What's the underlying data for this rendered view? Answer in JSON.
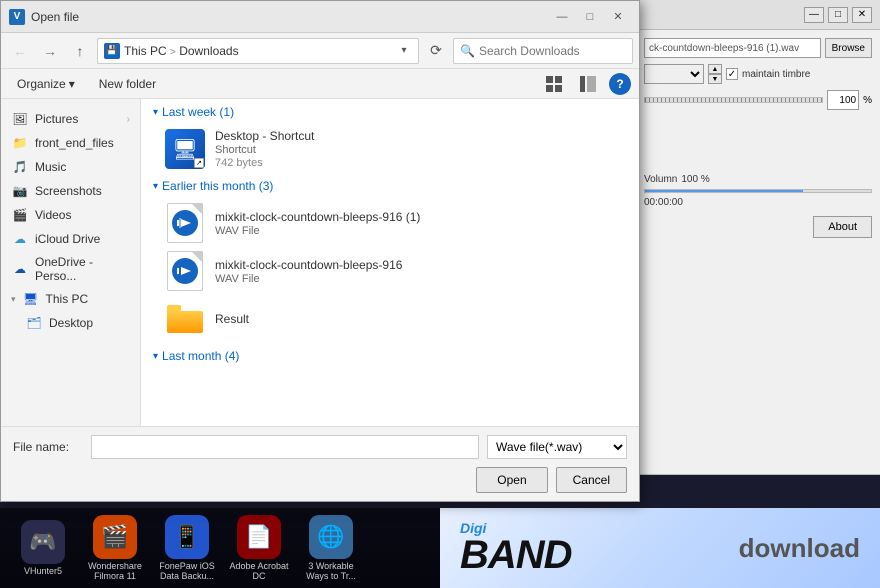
{
  "dialog": {
    "title": "Open file",
    "title_icon": "V",
    "nav": {
      "back_label": "←",
      "forward_label": "→",
      "up_label": "↑",
      "this_pc": "This PC",
      "separator": ">",
      "downloads": "Downloads",
      "dropdown_label": "▾",
      "refresh_label": "⟳",
      "search_placeholder": "Search Downloads"
    },
    "toolbar": {
      "organize_label": "Organize",
      "organize_arrow": "▾",
      "new_folder_label": "New folder",
      "view_label": "⊞",
      "help_label": "?"
    },
    "sidebar": {
      "items": [
        {
          "name": "Pictures",
          "icon": "🖼",
          "expanded": false
        },
        {
          "name": "front_end_files",
          "icon": "📁",
          "expanded": false
        },
        {
          "name": "Music",
          "icon": "🎵",
          "expanded": false
        },
        {
          "name": "Screenshots",
          "icon": "📷",
          "expanded": false
        },
        {
          "name": "Videos",
          "icon": "🎬",
          "expanded": false
        },
        {
          "name": "iCloud Drive",
          "icon": "☁",
          "expanded": false
        },
        {
          "name": "OneDrive - Perso...",
          "icon": "☁",
          "expanded": false
        },
        {
          "name": "This PC",
          "icon": "🖥",
          "expanded": true
        },
        {
          "name": "Desktop",
          "icon": "🗂",
          "expanded": false
        }
      ]
    },
    "groups": [
      {
        "id": "last_week",
        "label": "Last week (1)",
        "items": [
          {
            "type": "shortcut",
            "name": "Desktop - Shortcut",
            "subtype": "Shortcut",
            "size": "742 bytes"
          }
        ]
      },
      {
        "id": "earlier_this_month",
        "label": "Earlier this month (3)",
        "items": [
          {
            "type": "wav",
            "name": "mixkit-clock-countdown-bleeps-916 (1)",
            "subtype": "WAV File",
            "size": ""
          },
          {
            "type": "wav",
            "name": "mixkit-clock-countdown-bleeps-916",
            "subtype": "WAV File",
            "size": ""
          },
          {
            "type": "folder",
            "name": "Result",
            "subtype": "",
            "size": ""
          }
        ]
      },
      {
        "id": "last_month",
        "label": "Last month (4)",
        "items": []
      }
    ],
    "bottom": {
      "filename_label": "File name:",
      "filename_value": "",
      "filetype_value": "Wave file(*.wav)",
      "open_label": "Open",
      "cancel_label": "Cancel"
    }
  },
  "right_panel": {
    "input_value": "ck-countdown-bleeps-916 (1).wav",
    "browse_label": "Browse",
    "maintain_timbre": "maintain timbre",
    "percent_value": "100",
    "percent_symbol": "%",
    "volume_label": "Volumn",
    "volume_value": "100 %",
    "time_value": "00:00:00",
    "about_label": "About"
  },
  "taskbar": {
    "items": [
      {
        "label": "VHunter5",
        "icon": "🎮",
        "color": "#3a3a5c"
      },
      {
        "label": "Wondershare Filmora 11",
        "icon": "🎬",
        "color": "#ff6600"
      },
      {
        "label": "FonePaw iOS Data Backu...",
        "icon": "📱",
        "color": "#4488ff"
      },
      {
        "label": "Adobe Acrobat DC",
        "icon": "📄",
        "color": "#cc0000"
      },
      {
        "label": "3 Workable Ways to Tr...",
        "icon": "🌐",
        "color": "#4488cc"
      }
    ],
    "digi": {
      "digi_label": "Digi",
      "band_label": "BAND",
      "download_label": "download"
    }
  }
}
